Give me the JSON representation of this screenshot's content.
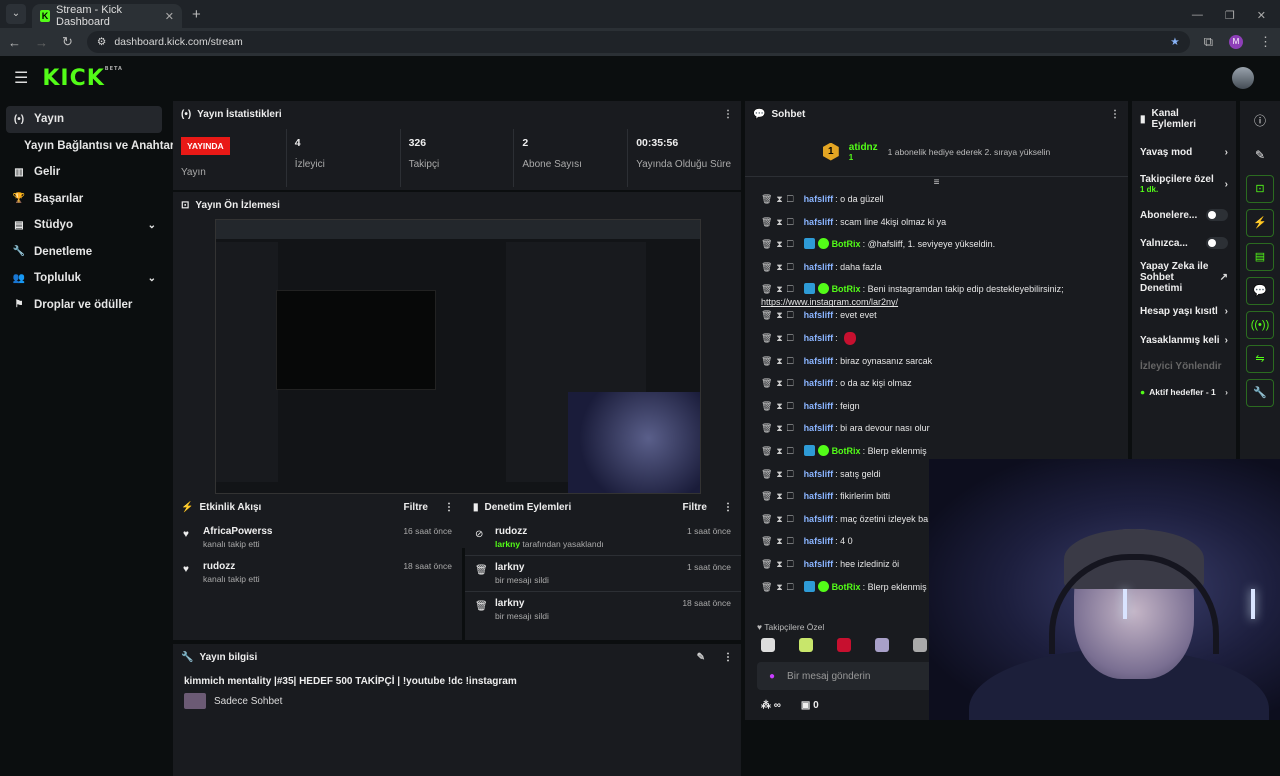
{
  "browser": {
    "tab_title": "Stream - Kick Dashboard",
    "url": "dashboard.kick.com/stream",
    "profile_initial": "M"
  },
  "app": {
    "logo": "KICK",
    "logo_beta": "BETA"
  },
  "sidebar": {
    "items": [
      {
        "label": "Yayın",
        "icon": "broadcast-icon"
      },
      {
        "label": "Yayın Bağlantısı ve Anahtarı"
      },
      {
        "label": "Gelir",
        "icon": "revenue-icon"
      },
      {
        "label": "Başarılar",
        "icon": "trophy-icon"
      },
      {
        "label": "Stüdyo",
        "icon": "studio-icon"
      },
      {
        "label": "Denetleme",
        "icon": "wrench-icon"
      },
      {
        "label": "Topluluk",
        "icon": "community-icon"
      },
      {
        "label": "Droplar ve ödüller",
        "icon": "drops-icon"
      }
    ]
  },
  "stats": {
    "title": "Yayın İstatistikleri",
    "live_badge": "YAYINDA",
    "live_label": "Yayın",
    "items": [
      {
        "value": "4",
        "label": "İzleyici"
      },
      {
        "value": "326",
        "label": "Takipçi"
      },
      {
        "value": "2",
        "label": "Abone Sayısı"
      },
      {
        "value": "00:35:56",
        "label": "Yayında Olduğu Süre"
      }
    ]
  },
  "preview": {
    "title": "Yayın Ön İzlemesi"
  },
  "events": {
    "title": "Etkinlik Akışı",
    "filter": "Filtre",
    "items": [
      {
        "name": "AfricaPowerss",
        "sub": "kanalı takip etti",
        "time": "16 saat önce"
      },
      {
        "name": "rudozz",
        "sub": "kanalı takip etti",
        "time": "18 saat önce"
      }
    ]
  },
  "mods": {
    "title": "Denetim Eylemleri",
    "filter": "Filtre",
    "items": [
      {
        "name": "rudozz",
        "sub_user": "larkny",
        "sub": " tarafından yasaklandı",
        "time": "1 saat önce"
      },
      {
        "name": "larkny",
        "sub_user": "",
        "sub": "bir mesajı sildi",
        "time": "1 saat önce"
      },
      {
        "name": "larkny",
        "sub_user": "",
        "sub": "bir mesajı sildi",
        "time": "18 saat önce"
      }
    ]
  },
  "info": {
    "title": "Yayın bilgisi",
    "stream_title": "kimmich mentality |#35| HEDEF 500 TAKİPÇİ | !youtube !dc !instagram",
    "category": "Sadece Sohbet"
  },
  "chat": {
    "title": "Sohbet",
    "gift_user": "atidnz",
    "gift_count": "1",
    "gift_msg": "1 abonelik hediye ederek 2. sıraya yükselin",
    "messages": [
      {
        "user": "hafsliff",
        "text": "o da güzell",
        "bot": false
      },
      {
        "user": "hafsliff",
        "text": "scam line 4kişi olmaz ki ya",
        "bot": false
      },
      {
        "user": "BotRix",
        "text": "@hafsliff, 1. seviyeye yükseldin.",
        "bot": true
      },
      {
        "user": "hafsliff",
        "text": "daha fazla",
        "bot": false
      },
      {
        "user": "BotRix",
        "text": "Beni instagramdan takip edip destekleyebilirsiniz;",
        "link": "https://www.instagram.com/lar2ny/",
        "bot": true
      },
      {
        "user": "hafsliff",
        "text": "evet evet",
        "bot": false
      },
      {
        "user": "hafsliff",
        "text": "",
        "emote": true,
        "bot": false
      },
      {
        "user": "hafsliff",
        "text": "biraz oynasanız sarcak",
        "bot": false
      },
      {
        "user": "hafsliff",
        "text": "o da az kişi olmaz",
        "bot": false
      },
      {
        "user": "hafsliff",
        "text": "feign",
        "bot": false
      },
      {
        "user": "hafsliff",
        "text": "bi ara devour nası olur",
        "bot": false
      },
      {
        "user": "BotRix",
        "text": "Blerp eklenmiş",
        "bot": true
      },
      {
        "user": "hafsliff",
        "text": "satış geldi",
        "bot": false
      },
      {
        "user": "hafsliff",
        "text": "fikirlerim bitti",
        "bot": false
      },
      {
        "user": "hafsliff",
        "text": "maç özetini izleyek ba",
        "bot": false
      },
      {
        "user": "hafsliff",
        "text": "4 0",
        "bot": false
      },
      {
        "user": "hafsliff",
        "text": "hee izlediniz öi",
        "bot": false
      },
      {
        "user": "BotRix",
        "text": "Blerp eklenmiş",
        "bot": true
      }
    ],
    "followers_only": "Takipçilere Özel",
    "input_placeholder": "Bir mesaj gönderin",
    "points": "∞",
    "gifts": "0"
  },
  "actions": {
    "title": "Kanal Eylemleri",
    "items": [
      {
        "label": "Yavaş mod",
        "type": "chevron"
      },
      {
        "label": "Takipçilere özel",
        "sub": "1 dk.",
        "type": "chevron"
      },
      {
        "label": "Abonelere...",
        "type": "toggle"
      },
      {
        "label": "Yalnızca...",
        "type": "toggle"
      },
      {
        "label": "Yapay Zeka ile Sohbet Denetimi",
        "type": "external"
      },
      {
        "label": "Hesap yaşı kısıtl",
        "type": "chevron"
      },
      {
        "label": "Yasaklanmış keli",
        "type": "chevron"
      },
      {
        "label": "İzleyici Yönlendir",
        "type": "dim"
      },
      {
        "label": "Aktif hedefler - 1",
        "type": "chevron"
      }
    ]
  },
  "colors": {
    "brand": "#53fc18",
    "live": "#e91916",
    "panel": "#191b1f",
    "bg": "#0b0e0f"
  }
}
